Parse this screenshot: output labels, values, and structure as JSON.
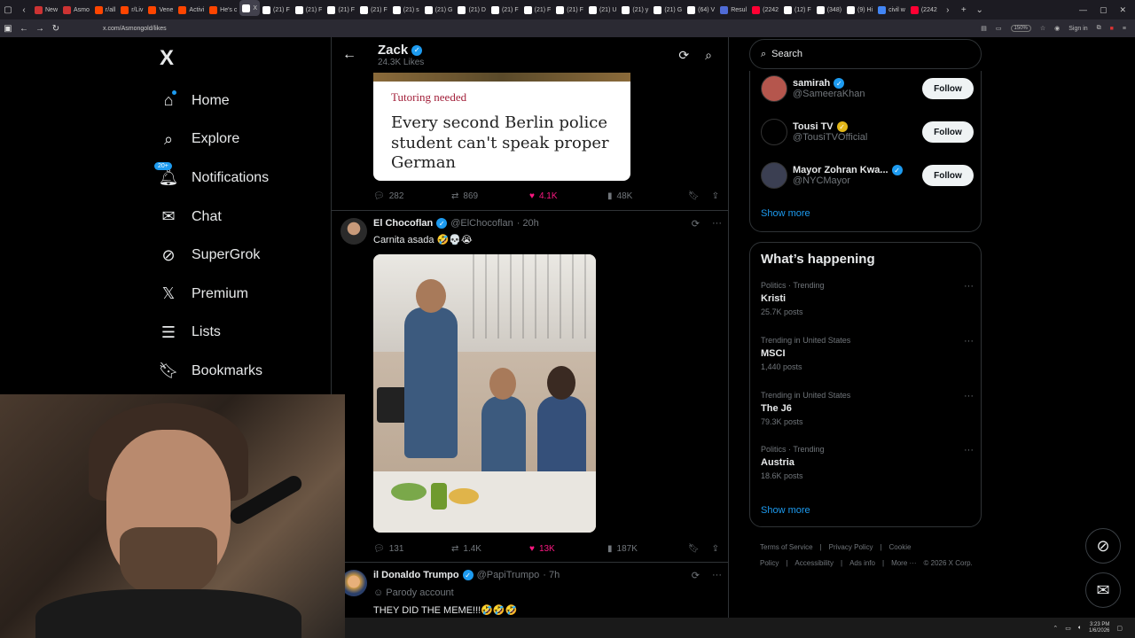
{
  "browser": {
    "tabs": [
      {
        "label": "New",
        "color": "#cc3333"
      },
      {
        "label": "Asmo",
        "color": "#cc3333"
      },
      {
        "label": "r/all",
        "color": "#ff4500"
      },
      {
        "label": "r/Liv",
        "color": "#ff4500"
      },
      {
        "label": "Vene",
        "color": "#ff4500"
      },
      {
        "label": "Activi",
        "color": "#ff4500"
      },
      {
        "label": "He's c",
        "color": "#ff4500"
      },
      {
        "label": "X",
        "color": "#ffffff"
      },
      {
        "label": "(21) F",
        "color": "#ffffff"
      },
      {
        "label": "(21) F",
        "color": "#ffffff"
      },
      {
        "label": "(21) F",
        "color": "#ffffff"
      },
      {
        "label": "(21) F",
        "color": "#ffffff"
      },
      {
        "label": "(21) s",
        "color": "#ffffff"
      },
      {
        "label": "(21) G",
        "color": "#ffffff"
      },
      {
        "label": "(21) D",
        "color": "#ffffff"
      },
      {
        "label": "(21) F",
        "color": "#ffffff"
      },
      {
        "label": "(21) F",
        "color": "#ffffff"
      },
      {
        "label": "(21) F",
        "color": "#ffffff"
      },
      {
        "label": "(21) U",
        "color": "#ffffff"
      },
      {
        "label": "(21) y",
        "color": "#ffffff"
      },
      {
        "label": "(21) G",
        "color": "#ffffff"
      },
      {
        "label": "(64) V",
        "color": "#ffffff"
      },
      {
        "label": "Resul",
        "color": "#4f6bd6"
      },
      {
        "label": "(2242",
        "color": "#ff0033"
      },
      {
        "label": "(12) F",
        "color": "#ffffff"
      },
      {
        "label": "(348)",
        "color": "#ffffff"
      },
      {
        "label": "(9) Hi",
        "color": "#ffffff"
      },
      {
        "label": "civil w",
        "color": "#4285f4"
      },
      {
        "label": "(2242",
        "color": "#ff0033"
      }
    ],
    "url": "x.com/Asmongold/likes",
    "zoom": "150%",
    "signin": "Sign in"
  },
  "nav": {
    "logo": "X",
    "items": [
      {
        "label": "Home",
        "icon": "home-icon"
      },
      {
        "label": "Explore",
        "icon": "search-icon"
      },
      {
        "label": "Notifications",
        "icon": "bell-icon",
        "badge": "20+"
      },
      {
        "label": "Chat",
        "icon": "mail-icon"
      },
      {
        "label": "SuperGrok",
        "icon": "grok-icon"
      },
      {
        "label": "Premium",
        "icon": "x-icon"
      },
      {
        "label": "Lists",
        "icon": "list-icon"
      },
      {
        "label": "Bookmarks",
        "icon": "bookmark-icon"
      }
    ]
  },
  "profile_header": {
    "name": "Zack",
    "likes": "24.3K Likes"
  },
  "tweet1": {
    "card_tag": "Tutoring needed",
    "card_headline": "Every second Berlin police student can't speak proper German",
    "replies": "282",
    "retweets": "869",
    "likes": "4.1K",
    "views": "48K"
  },
  "tweet2": {
    "name": "El Chocoflan",
    "handle": "@ElChocoflan",
    "time": "· 20h",
    "text": "Carnita asada 🤣💀😭",
    "replies": "131",
    "retweets": "1.4K",
    "likes": "13K",
    "views": "187K"
  },
  "tweet3": {
    "name": "il Donaldo Trumpo",
    "handle": "@PapiTrumpo",
    "time": "· 7h",
    "parody": "Parody account",
    "text": "THEY DID THE MEME!!!🤣🤣🤣"
  },
  "sidebar": {
    "search_placeholder": "Search",
    "who_to_follow": [
      {
        "name": "samirah",
        "handle": "@SameeraKhan",
        "badge": "blue",
        "avatar": "#b5564d"
      },
      {
        "name": "Tousi TV",
        "handle": "@TousiTVOfficial",
        "badge": "gold",
        "avatar": "#000000"
      },
      {
        "name": "Mayor Zohran Kwa...",
        "handle": "@NYCMayor",
        "badge": "blue",
        "avatar": "#3b3f52"
      }
    ],
    "follow_label": "Follow",
    "show_more": "Show more",
    "trending_title": "What’s happening",
    "trends": [
      {
        "context": "Politics · Trending",
        "topic": "Kristi",
        "count": "25.7K posts"
      },
      {
        "context": "Trending in United States",
        "topic": "MSCI",
        "count": "1,440 posts"
      },
      {
        "context": "Trending in United States",
        "topic": "The J6",
        "count": "79.3K posts"
      },
      {
        "context": "Politics · Trending",
        "topic": "Austria",
        "count": "18.6K posts"
      }
    ],
    "trends_show_more": "Show more",
    "footer": [
      "Terms of Service",
      "|",
      "Privacy Policy",
      "|",
      "Cookie Policy",
      "|",
      "Accessibility",
      "|",
      "Ads info",
      "|",
      "More ···",
      "© 2026 X Corp."
    ]
  },
  "taskbar": {
    "time": "3:23 PM",
    "date": "1/6/2026"
  }
}
